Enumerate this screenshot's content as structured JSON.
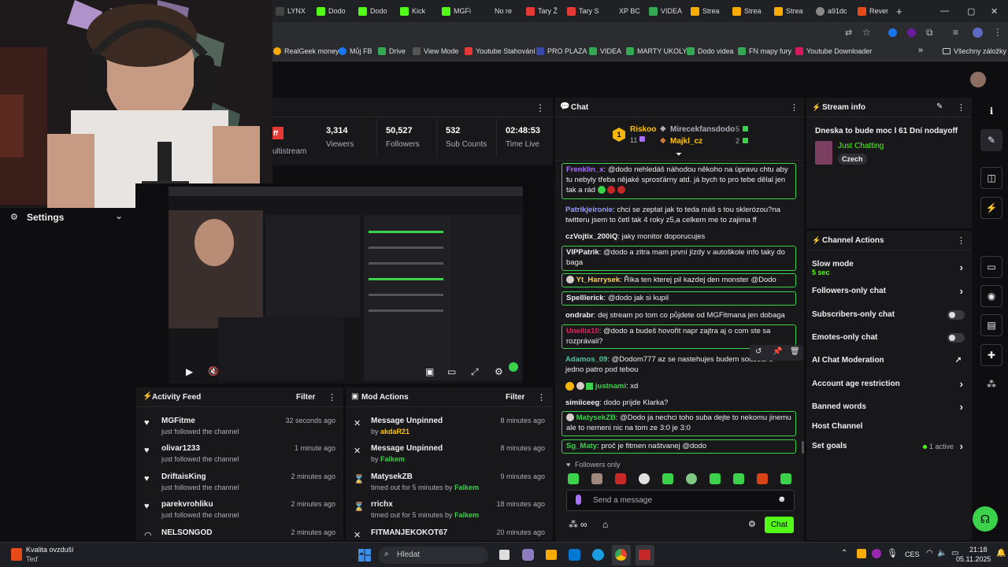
{
  "browser": {
    "tabs": [
      "LYNX",
      "Dodo",
      "Dodo",
      "Kick",
      "MGFi",
      "No re",
      "Tary Ž",
      "Tary S",
      "XP BC",
      "VIDEA",
      "Strea",
      "Strea",
      "Strea",
      "a91dc",
      "Rever"
    ],
    "new_tab": "+",
    "bookmarks": [
      "RealGeek money",
      "Můj FB",
      "Drive",
      "View Mode",
      "Youtube Stahování",
      "PRO PLAZA",
      "VIDEA",
      "MARTY UKOLY",
      "Dodo videa",
      "FN mapy fury",
      "Youtube Downloader"
    ],
    "bookmarks_more": "»",
    "all_bookmarks": "Všechny záložky",
    "window_controls": [
      "—",
      "▢",
      "✕"
    ]
  },
  "settings": {
    "label": "Settings"
  },
  "stats": {
    "partial_badge": "ff",
    "partial_label": "ultistream",
    "viewers": {
      "value": "3,314",
      "label": "Viewers"
    },
    "followers": {
      "value": "50,527",
      "label": "Followers"
    },
    "subs": {
      "value": "532",
      "label": "Sub Counts"
    },
    "time": {
      "value": "02:48:53",
      "label": "Time Live"
    }
  },
  "player": {
    "play": "▶",
    "mute": "🔇"
  },
  "activity": {
    "title": "Activity Feed",
    "filter": "Filter",
    "items": [
      {
        "name": "MGFitme",
        "action": "just followed the channel",
        "time": "32 seconds ago"
      },
      {
        "name": "olivar1233",
        "action": "just followed the channel",
        "time": "1 minute ago"
      },
      {
        "name": "DriftaisKing",
        "action": "just followed the channel",
        "time": "2 minutes ago"
      },
      {
        "name": "parekvrohliku",
        "action": "just followed the channel",
        "time": "2 minutes ago"
      },
      {
        "name": "NELSONGOD",
        "action": "",
        "time": "2 minutes ago"
      }
    ]
  },
  "mod": {
    "title": "Mod Actions",
    "filter": "Filter",
    "items": [
      {
        "title": "Message Unpinned",
        "by": "by ",
        "who": "akdaR21",
        "time": "8 minutes ago"
      },
      {
        "title": "Message Unpinned",
        "by": "by ",
        "who": "Falkem",
        "time": "8 minutes ago"
      },
      {
        "title": "MatysekZB",
        "by": "timed out for 5 minutes by ",
        "who": "Falkem",
        "time": "9 minutes ago"
      },
      {
        "title": "rrichx",
        "by": "timed out for 5 minutes by ",
        "who": "Falkem",
        "time": "18 minutes ago"
      },
      {
        "title": "FITMANJEKOKOT67",
        "by": "",
        "who": "",
        "time": "20 minutes ago"
      }
    ]
  },
  "chat": {
    "title": "Chat",
    "top_rank": "1",
    "top_user": "Riskoo",
    "top_count": "11",
    "gifter2": "Mirecekfansdodo",
    "gifter2_count": "5",
    "gifter3": "Majkl_cz",
    "gifter3_count": "2",
    "messages": [
      {
        "user": "Frenklin_x",
        "color": "#a970ff",
        "text": "@dodo nehledáš náhodou někoho na úpravu chtu aby tu nebyly třeba nějaké sprosťárny atd. já bych to pro tebe dělal jen tak a rád"
      },
      {
        "user": "Patrikjeironie",
        "color": "#9b9bff",
        "text": "chci se zeptat jak to teda máš s tou sklerózou?na twitteru jsem to četl tak 4 roky z5,a celkem me to zajima ff"
      },
      {
        "user": "czVojtix_200iQ",
        "color": "#efeff1",
        "text": "jaky monitor doporucujes"
      },
      {
        "user": "VIPPatrik",
        "color": "#efeff1",
        "text": "@dodo a zitra mam první jízdy v autoškole info taky do baga"
      },
      {
        "user": "Yt_Harrysek",
        "color": "#ffd54f",
        "text": "Řika ten kterej pil kazdej den monster @Dodo"
      },
      {
        "user": "Spelllerick",
        "color": "#efeff1",
        "text": "@dodo jak si kupil"
      },
      {
        "user": "ondrabr",
        "color": "#efeff1",
        "text": "dej stream po tom co půjdete od MGFitmana jen dobaga"
      },
      {
        "user": "Uneilix10",
        "color": "#e0245e",
        "text": "@dodo a budeš hovořit napr zajtra aj o com ste sa rozprávali?"
      },
      {
        "user": "Adamos_09",
        "color": "#4fc3a1",
        "text": "@Dodom777 az se nastehujes budem sousedi o jedno patro pod tebou"
      },
      {
        "user": "justnami",
        "color": "#3bd14a",
        "text": "xd"
      },
      {
        "user": "simiiceeg",
        "color": "#efeff1",
        "text": "dodo prijde Klarka?"
      },
      {
        "user": "MatysekZB",
        "color": "#3bd14a",
        "text": "@Dodo ja nechci toho suba dejte to nekomu jinemu ale to nemeni nic na tom ze 3:0 je 3:0"
      },
      {
        "user": "Sg_Maty",
        "color": "#3bd14a",
        "text": "proč je fitmen naštvanej @dodo"
      }
    ],
    "followers_only": "Followers only",
    "placeholder": "Send a message",
    "send": "Chat"
  },
  "stream_info": {
    "title": "Stream info",
    "stream_title": "Dneska to bude moc l 61 Dní nodayoff",
    "category": "Just Chatting",
    "tag": "Czech"
  },
  "channel_actions": {
    "title": "Channel Actions",
    "slow_mode": "Slow mode",
    "slow_sub": "5 sec",
    "followers_only": "Followers-only chat",
    "subscribers_only": "Subscribers-only chat",
    "emotes_only": "Emotes-only chat",
    "ai_mod": "AI Chat Moderation",
    "account_age": "Account age restriction",
    "banned_words": "Banned words",
    "host": "Host Channel",
    "goals": "Set goals",
    "goals_status": "1 active"
  },
  "taskbar": {
    "weather": "Kvalita ovzduší",
    "weather_sub": "Teď",
    "search": "Hledat",
    "lang": "CES",
    "time": "21:18",
    "date": "05.11.2025"
  },
  "colors": {
    "accent": "#53fc18",
    "panel": "#18181b",
    "bg": "#0e0e10"
  }
}
